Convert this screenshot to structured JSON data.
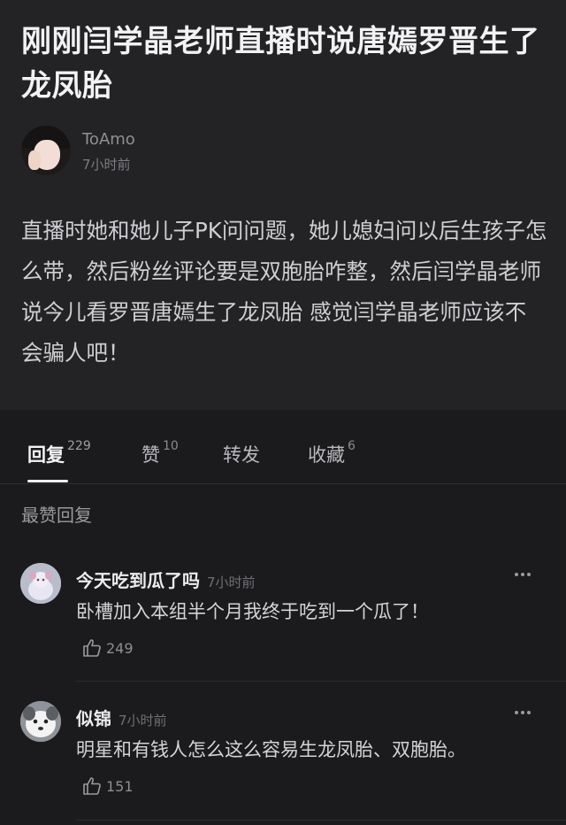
{
  "post": {
    "title": "刚刚闫学晶老师直播时说唐嫣罗晋生了龙凤胎",
    "author_name": "ToAmo",
    "author_time": "7小时前",
    "body": "直播时她和她儿子PK问问题，她儿媳妇问以后生孩子怎么带，然后粉丝评论要是双胞胎咋整，然后闫学晶老师说今儿看罗晋唐嫣生了龙凤胎 感觉闫学晶老师应该不会骗人吧！"
  },
  "tabs": [
    {
      "label": "回复",
      "count": "229"
    },
    {
      "label": "赞",
      "count": "10"
    },
    {
      "label": "转发",
      "count": ""
    },
    {
      "label": "收藏",
      "count": "6"
    }
  ],
  "section_label": "最赞回复",
  "comments": [
    {
      "name": "今天吃到瓜了吗",
      "time": "7小时前",
      "text": "卧槽加入本组半个月我终于吃到一个瓜了！",
      "likes": "249"
    },
    {
      "name": "似锦",
      "time": "7小时前",
      "text": "明星和有钱人怎么这么容易生龙凤胎、双胞胎。",
      "likes": "151"
    }
  ],
  "icons": {
    "more": "more-dots-icon",
    "like": "thumbs-up-icon"
  },
  "colors": {
    "background": "#1b1b1d",
    "post_background": "#232325",
    "text_primary": "#f2f2f4",
    "text_secondary": "#8f8f94"
  }
}
